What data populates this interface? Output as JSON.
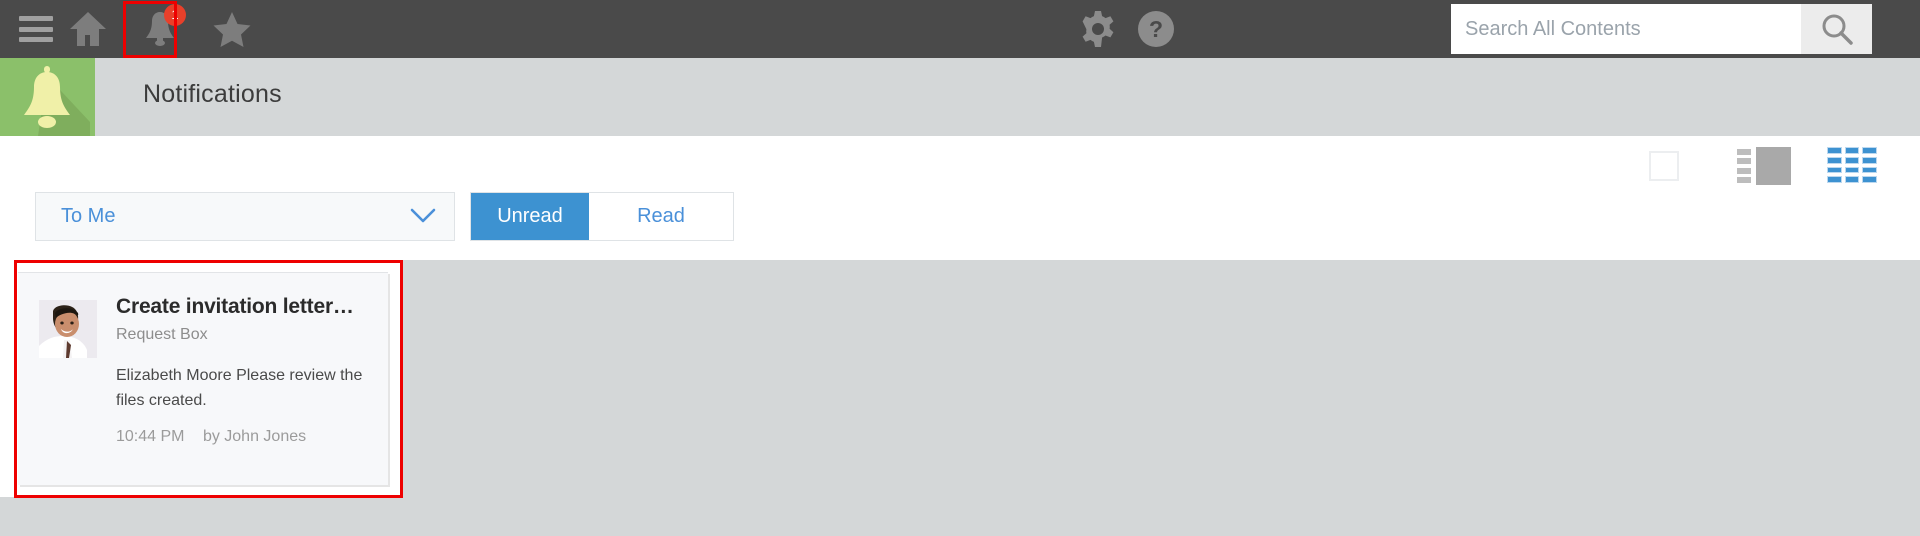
{
  "topbar": {
    "menu_icon": "hamburger-icon",
    "home_icon": "home-icon",
    "bell_icon": "bell-icon",
    "bell_badge": "1",
    "star_icon": "star-icon",
    "gear_icon": "gear-icon",
    "help_icon": "help-icon",
    "search_icon": "search-icon",
    "search_value": "",
    "search_placeholder": "Search All Contents",
    "bar_color": "#4a4a4a",
    "badge_color": "#e8402a"
  },
  "header": {
    "app_icon": "bell-icon",
    "title": "Notifications",
    "tile_color": "#8bc06a",
    "band_color": "#d4d7d8"
  },
  "toolbar": {
    "filter": {
      "selected": "To Me",
      "chevron_icon": "chevron-down-icon"
    },
    "tabs": [
      {
        "label": "Unread",
        "active": true
      },
      {
        "label": "Read",
        "active": false
      }
    ],
    "select_all_checkbox": {
      "name": "select-all-checkbox",
      "checked": false
    },
    "view_list_icon": "list-view-icon",
    "view_grid_icon": "grid-view-icon",
    "accent_color": "#3d92d1",
    "link_color": "#4a90d9"
  },
  "notifications": [
    {
      "avatar": "user-avatar",
      "title": "Create invitation letter…",
      "source": "Request Box",
      "message": "Elizabeth Moore Please review the files created.",
      "time": "10:44 PM",
      "author": "by John Jones"
    }
  ],
  "highlights": {
    "color": "#ee0000",
    "bell_region": "notification-bell-highlight",
    "card_region": "notification-card-highlight"
  }
}
